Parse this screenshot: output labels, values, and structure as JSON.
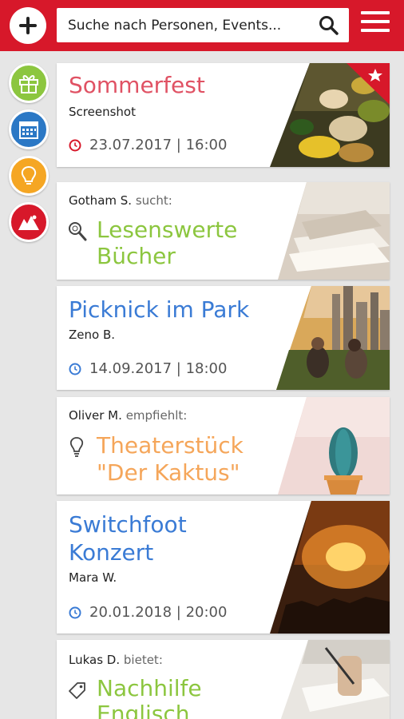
{
  "header": {
    "search_placeholder": "Suche nach Personen, Events..."
  },
  "categories": [
    {
      "name": "gift",
      "color": "#8cc63f"
    },
    {
      "name": "calendar",
      "color": "#2b78c5"
    },
    {
      "name": "idea",
      "color": "#f5a623"
    },
    {
      "name": "camp",
      "color": "#d7182a"
    }
  ],
  "cards": {
    "sommerfest": {
      "title": "Sommerfest",
      "subtitle": "Screenshot",
      "datetime": "23.07.2017 | 16:00"
    },
    "gotham": {
      "author": "Gotham S.",
      "verb": "sucht:",
      "line1": "Lesenswerte",
      "line2": "Bücher"
    },
    "picknick": {
      "title": "Picknick im Park",
      "subtitle": "Zeno B.",
      "datetime": "14.09.2017 | 18:00"
    },
    "oliver": {
      "author": "Oliver M.",
      "verb": "empfiehlt:",
      "line1": "Theaterstück",
      "line2": "\"Der Kaktus\""
    },
    "switchfoot": {
      "title1": "Switchfoot",
      "title2": "Konzert",
      "subtitle": "Mara W.",
      "datetime": "20.01.2018 | 20:00"
    },
    "lukas": {
      "author": "Lukas D.",
      "verb": "bietet:",
      "line1": "Nachhilfe",
      "line2": "Englisch"
    }
  },
  "colors": {
    "brand_red": "#d7182a",
    "event_blue": "#3a7bd5",
    "offer_green": "#8cc63f",
    "tip_orange": "#f5a623"
  }
}
